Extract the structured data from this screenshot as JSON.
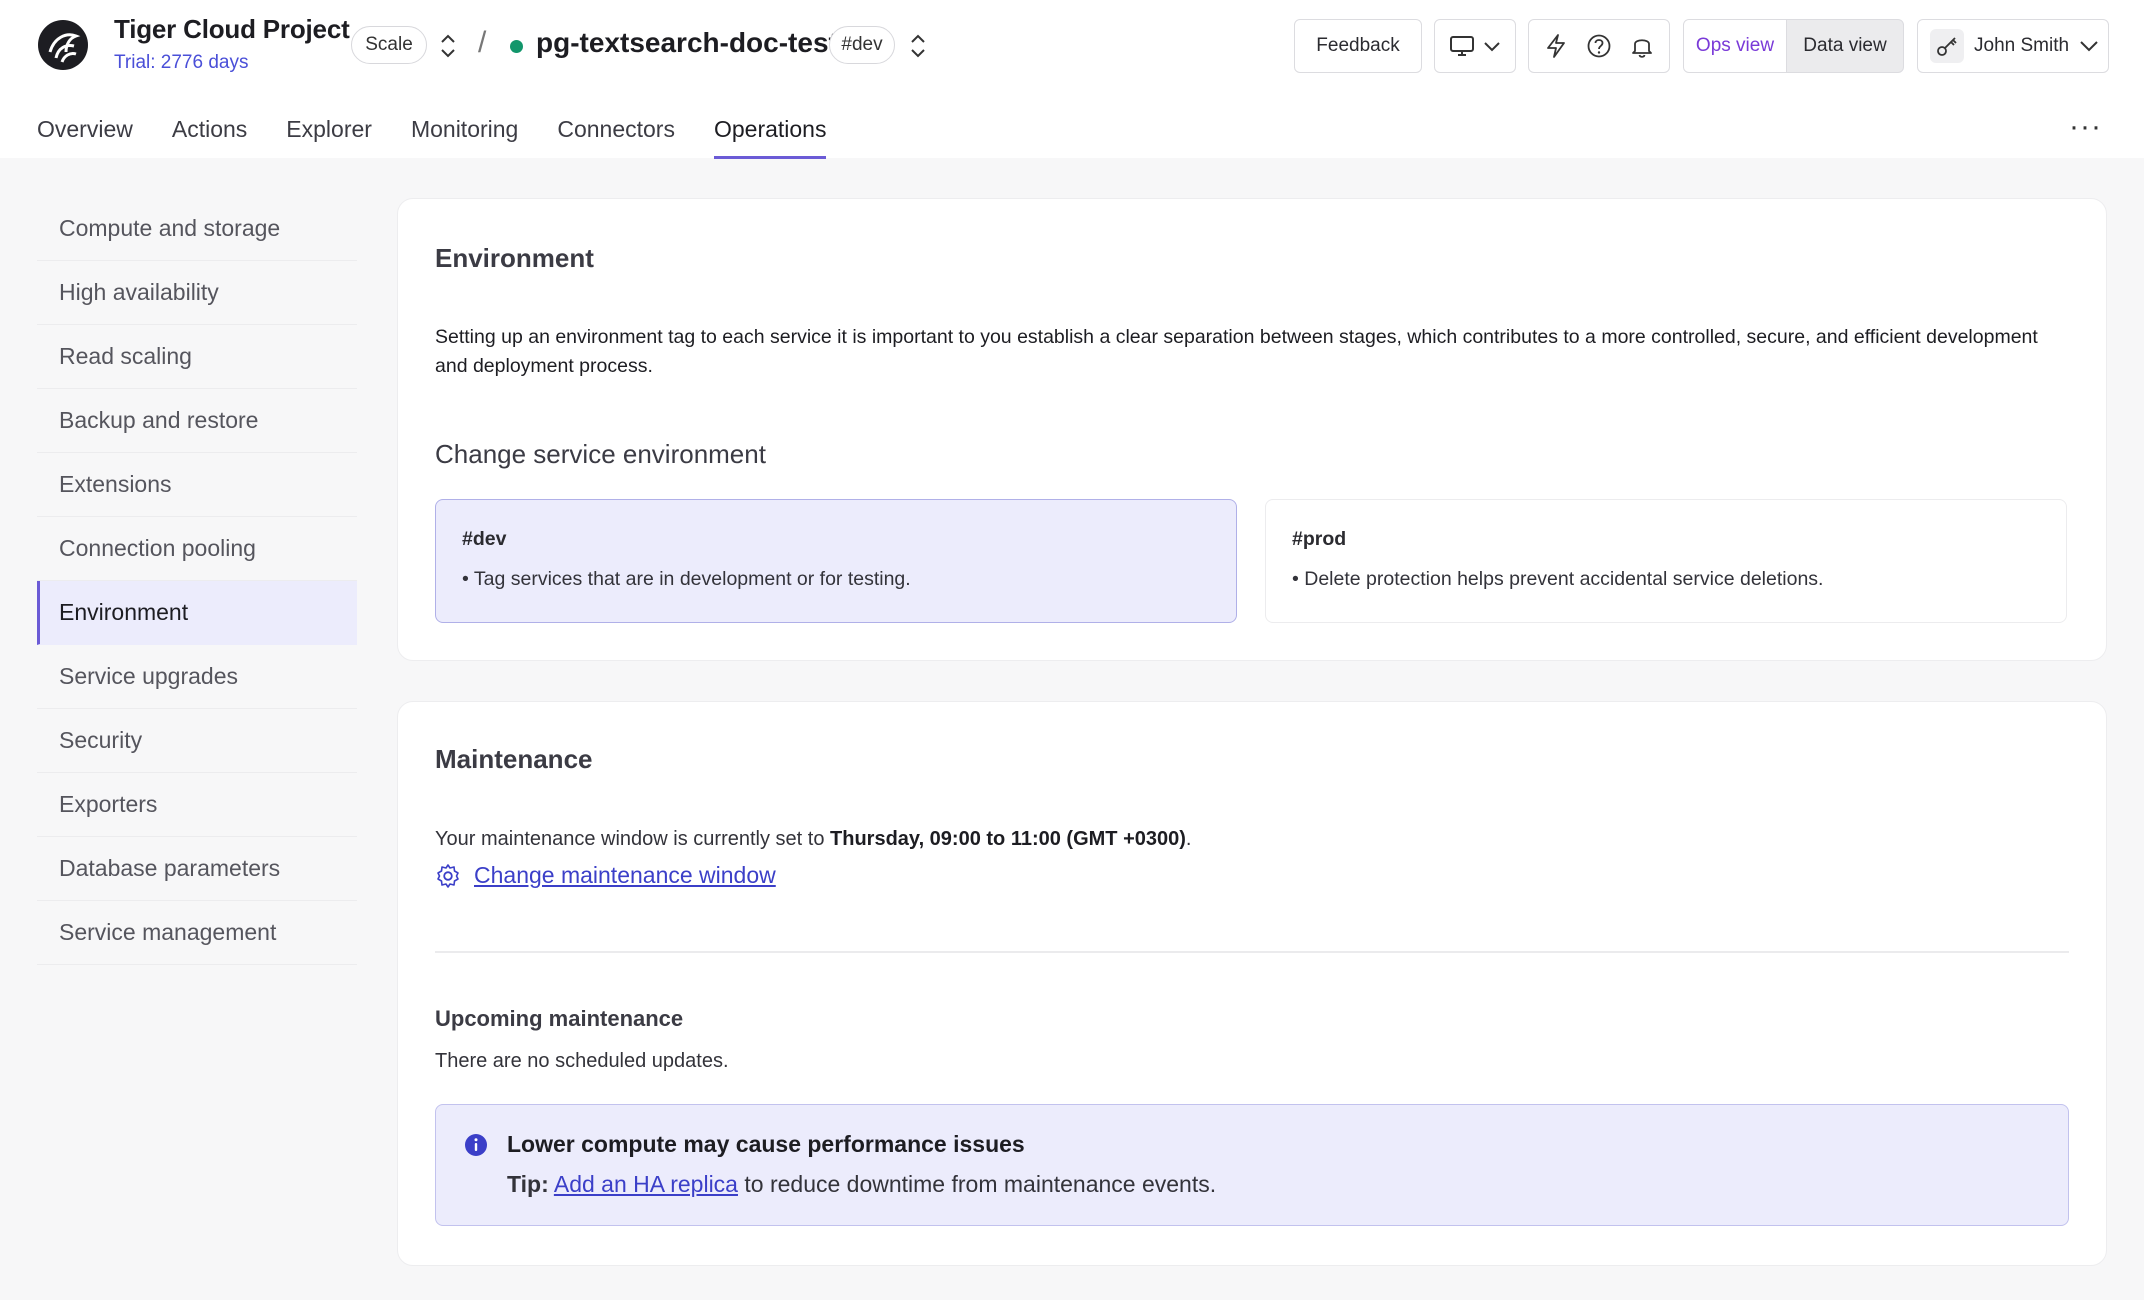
{
  "header": {
    "project_title": "Tiger Cloud Project",
    "trial": "Trial: 2776 days",
    "plan_badge": "Scale",
    "separator": "/",
    "service_name": "pg-textsearch-doc-test",
    "service_env_badge": "#dev",
    "status_color": "#12966b",
    "feedback_label": "Feedback",
    "ops_view_label": "Ops view",
    "data_view_label": "Data view",
    "user_name": "John Smith",
    "more_label": "···"
  },
  "tabs": [
    {
      "label": "Overview",
      "active": false
    },
    {
      "label": "Actions",
      "active": false
    },
    {
      "label": "Explorer",
      "active": false
    },
    {
      "label": "Monitoring",
      "active": false
    },
    {
      "label": "Connectors",
      "active": false
    },
    {
      "label": "Operations",
      "active": true
    }
  ],
  "sidebar": {
    "items": [
      {
        "label": "Compute and storage"
      },
      {
        "label": "High availability"
      },
      {
        "label": "Read scaling"
      },
      {
        "label": "Backup and restore"
      },
      {
        "label": "Extensions"
      },
      {
        "label": "Connection pooling"
      },
      {
        "label": "Environment",
        "active": true
      },
      {
        "label": "Service upgrades"
      },
      {
        "label": "Security"
      },
      {
        "label": "Exporters"
      },
      {
        "label": "Database parameters"
      },
      {
        "label": "Service management"
      }
    ]
  },
  "environment": {
    "title": "Environment",
    "description": "Setting up an environment tag to each service it is important to you establish a clear separation between stages, which contributes to a more controlled, secure, and efficient development and deployment process.",
    "change_title": "Change service environment",
    "options": [
      {
        "tag": "#dev",
        "desc": "• Tag services that are in development or for testing.",
        "selected": true
      },
      {
        "tag": "#prod",
        "desc": "• Delete protection helps prevent accidental service deletions.",
        "selected": false
      }
    ]
  },
  "maintenance": {
    "title": "Maintenance",
    "window_prefix": "Your maintenance window is currently set to ",
    "window_value": "Thursday, 09:00 to 11:00 (GMT +0300)",
    "window_suffix": ".",
    "change_link": "Change maintenance window",
    "upcoming_title": "Upcoming maintenance",
    "upcoming_text": "There are no scheduled updates.",
    "alert": {
      "title": "Lower compute may cause performance issues",
      "tip_label": "Tip:",
      "tip_link": "Add an HA replica",
      "tip_suffix": " to reduce downtime from maintenance events."
    }
  },
  "colors": {
    "accent": "#6b5bd6",
    "link": "#3b3fc8",
    "selected_bg": "#ececfc"
  }
}
